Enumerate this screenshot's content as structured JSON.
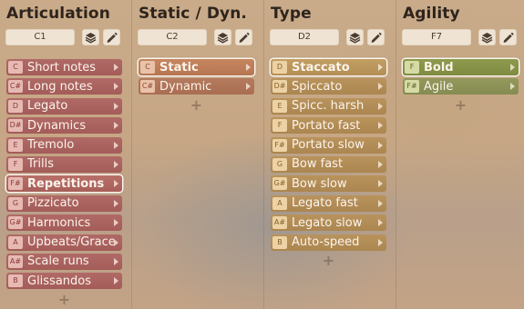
{
  "panels": [
    {
      "title": "Articulation",
      "key": "C1",
      "theme": "red",
      "items": [
        {
          "key": "C",
          "label": "Short notes"
        },
        {
          "key": "C#",
          "label": "Long notes"
        },
        {
          "key": "D",
          "label": "Legato"
        },
        {
          "key": "D#",
          "label": "Dynamics"
        },
        {
          "key": "E",
          "label": "Tremolo"
        },
        {
          "key": "F",
          "label": "Trills"
        },
        {
          "key": "F#",
          "label": "Repetitions",
          "selected": true
        },
        {
          "key": "G",
          "label": "Pizzicato"
        },
        {
          "key": "G#",
          "label": "Harmonics"
        },
        {
          "key": "A",
          "label": "Upbeats/Grace"
        },
        {
          "key": "A#",
          "label": "Scale runs"
        },
        {
          "key": "B",
          "label": "Glissandos"
        }
      ]
    },
    {
      "title": "Static / Dyn.",
      "key": "C2",
      "theme": "orange",
      "items": [
        {
          "key": "C",
          "label": "Static",
          "selected": true
        },
        {
          "key": "C#",
          "label": "Dynamic"
        }
      ]
    },
    {
      "title": "Type",
      "key": "D2",
      "theme": "gold",
      "items": [
        {
          "key": "D",
          "label": "Staccato",
          "selected": true
        },
        {
          "key": "D#",
          "label": "Spiccato"
        },
        {
          "key": "E",
          "label": "Spicc. harsh"
        },
        {
          "key": "F",
          "label": "Portato fast"
        },
        {
          "key": "F#",
          "label": "Portato slow"
        },
        {
          "key": "G",
          "label": "Bow fast"
        },
        {
          "key": "G#",
          "label": "Bow slow"
        },
        {
          "key": "A",
          "label": "Legato fast"
        },
        {
          "key": "A#",
          "label": "Legato slow"
        },
        {
          "key": "B",
          "label": "Auto-speed"
        }
      ]
    },
    {
      "title": "Agility",
      "key": "F7",
      "theme": "olive",
      "items": [
        {
          "key": "F",
          "label": "Bold",
          "selected": true
        },
        {
          "key": "F#",
          "label": "Agile"
        }
      ]
    }
  ],
  "icons": {
    "layers": "layers-icon",
    "edit": "pencil-icon",
    "add": "plus-icon",
    "submenu": "triangle-right-icon"
  },
  "add_symbol": "+"
}
